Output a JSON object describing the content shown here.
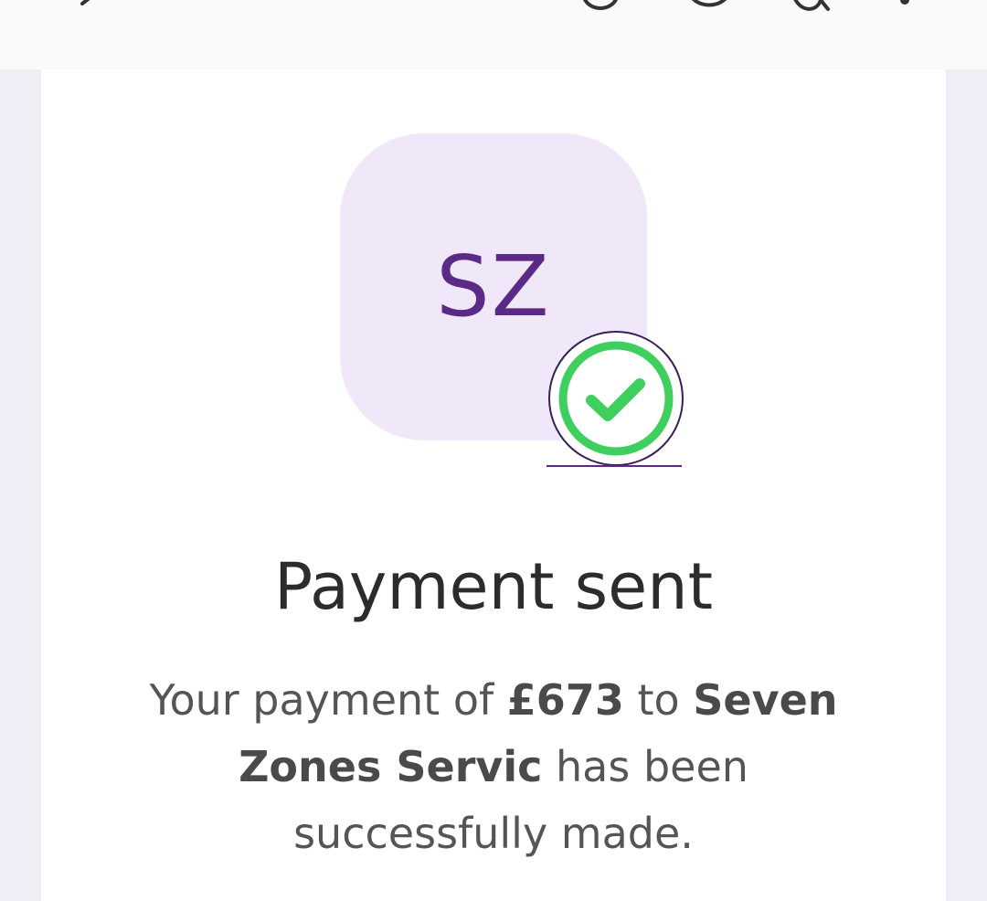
{
  "topbar": {
    "back_icon": "chevron-left-icon",
    "action_icons": [
      "share-icon",
      "help-icon",
      "support-icon",
      "more-vertical-icon"
    ]
  },
  "avatar": {
    "initials": "SZ",
    "background_color": "#f0e8f8",
    "text_color": "#5b2a86"
  },
  "status_badge": {
    "icon": "check-circle-icon",
    "color": "#3ecf5e"
  },
  "confirmation": {
    "title": "Payment sent",
    "message_prefix": "Your payment of ",
    "amount": "£673",
    "message_to": " to ",
    "recipient": "Seven Zones Servic",
    "message_suffix": " has been successfully made."
  }
}
